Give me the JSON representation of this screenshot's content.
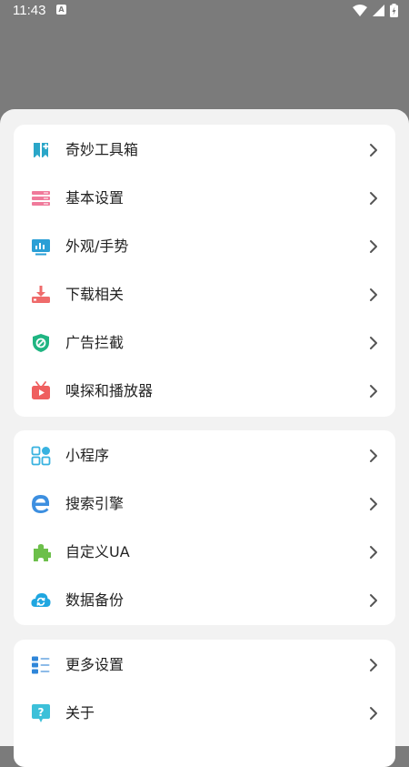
{
  "status_bar": {
    "time": "11:43",
    "notify_badge": "A"
  },
  "colors": {
    "overlay": "#7b7b7b",
    "sheet": "#f2f2f2",
    "card": "#ffffff",
    "text": "#222222",
    "chevron": "#555555"
  },
  "group1": [
    {
      "label": "奇妙工具箱",
      "icon": "toolbox-icon",
      "color": "#2aa6c8"
    },
    {
      "label": "基本设置",
      "icon": "settings-panel-icon",
      "color": "#f07a9b"
    },
    {
      "label": "外观/手势",
      "icon": "chart-monitor-icon",
      "color": "#2a9fd6"
    },
    {
      "label": "下载相关",
      "icon": "download-icon",
      "color": "#ef6b6b"
    },
    {
      "label": "广告拦截",
      "icon": "shield-block-icon",
      "color": "#1fb582"
    },
    {
      "label": "嗅探和播放器",
      "icon": "tv-play-icon",
      "color": "#ef5f5f"
    }
  ],
  "group2": [
    {
      "label": "小程序",
      "icon": "grid-apps-icon",
      "color": "#38b2e0"
    },
    {
      "label": "搜索引擎",
      "icon": "browser-e-icon",
      "color": "#3d8fe0"
    },
    {
      "label": "自定义UA",
      "icon": "puzzle-icon",
      "color": "#6cbf4a"
    },
    {
      "label": "数据备份",
      "icon": "cloud-sync-icon",
      "color": "#1fa6e0"
    }
  ],
  "group3": [
    {
      "label": "更多设置",
      "icon": "list-icon",
      "color": "#2f86d9"
    },
    {
      "label": "关于",
      "icon": "help-bubble-icon",
      "color": "#3cc0d9"
    }
  ]
}
